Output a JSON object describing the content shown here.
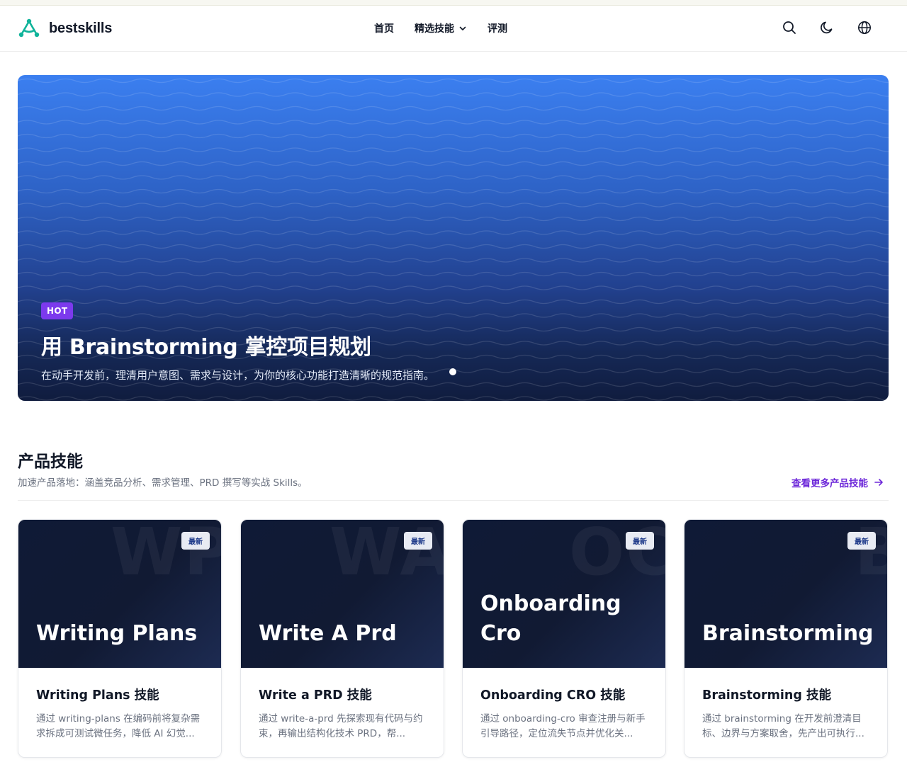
{
  "brand": {
    "name": "bestskills",
    "accent": "#10b39a"
  },
  "nav": {
    "items": [
      {
        "label": "首页",
        "dropdown": false
      },
      {
        "label": "精选技能",
        "dropdown": true
      },
      {
        "label": "评测",
        "dropdown": false
      }
    ]
  },
  "header_icons": [
    "search-icon",
    "moon-icon",
    "globe-icon"
  ],
  "hero": {
    "badge": "HOT",
    "title": "用 Brainstorming 掌控项目规划",
    "subtitle": "在动手开发前，理清用户意图、需求与设计，为你的核心功能打造清晰的规范指南。",
    "badge_color": "#7c3aed"
  },
  "section": {
    "title": "产品技能",
    "description": "加速产品落地：涵盖竞品分析、需求管理、PRD 撰写等实战 Skills。",
    "more_label": "查看更多产品技能",
    "more_color": "#6d28d9"
  },
  "cards": [
    {
      "badge": "最新",
      "watermark": "WP",
      "cover_title": "Writing Plans",
      "title": "Writing Plans 技能",
      "desc": "通过 writing-plans 在编码前将复杂需求拆成可测试微任务，降低 AI 幻觉..."
    },
    {
      "badge": "最新",
      "watermark": "WA",
      "cover_title": "Write A Prd",
      "title": "Write a PRD 技能",
      "desc": "通过 write-a-prd 先探索现有代码与约束，再输出结构化技术 PRD，帮..."
    },
    {
      "badge": "最新",
      "watermark": "OC",
      "cover_title": "Onboarding Cro",
      "title": "Onboarding CRO 技能",
      "desc": "通过 onboarding-cro 审查注册与新手引导路径，定位流失节点并优化关..."
    },
    {
      "badge": "最新",
      "watermark": "B",
      "cover_title": "Brainstorming",
      "title": "Brainstorming 技能",
      "desc": "通过 brainstorming 在开发前澄清目标、边界与方案取舍，先产出可执行..."
    }
  ]
}
